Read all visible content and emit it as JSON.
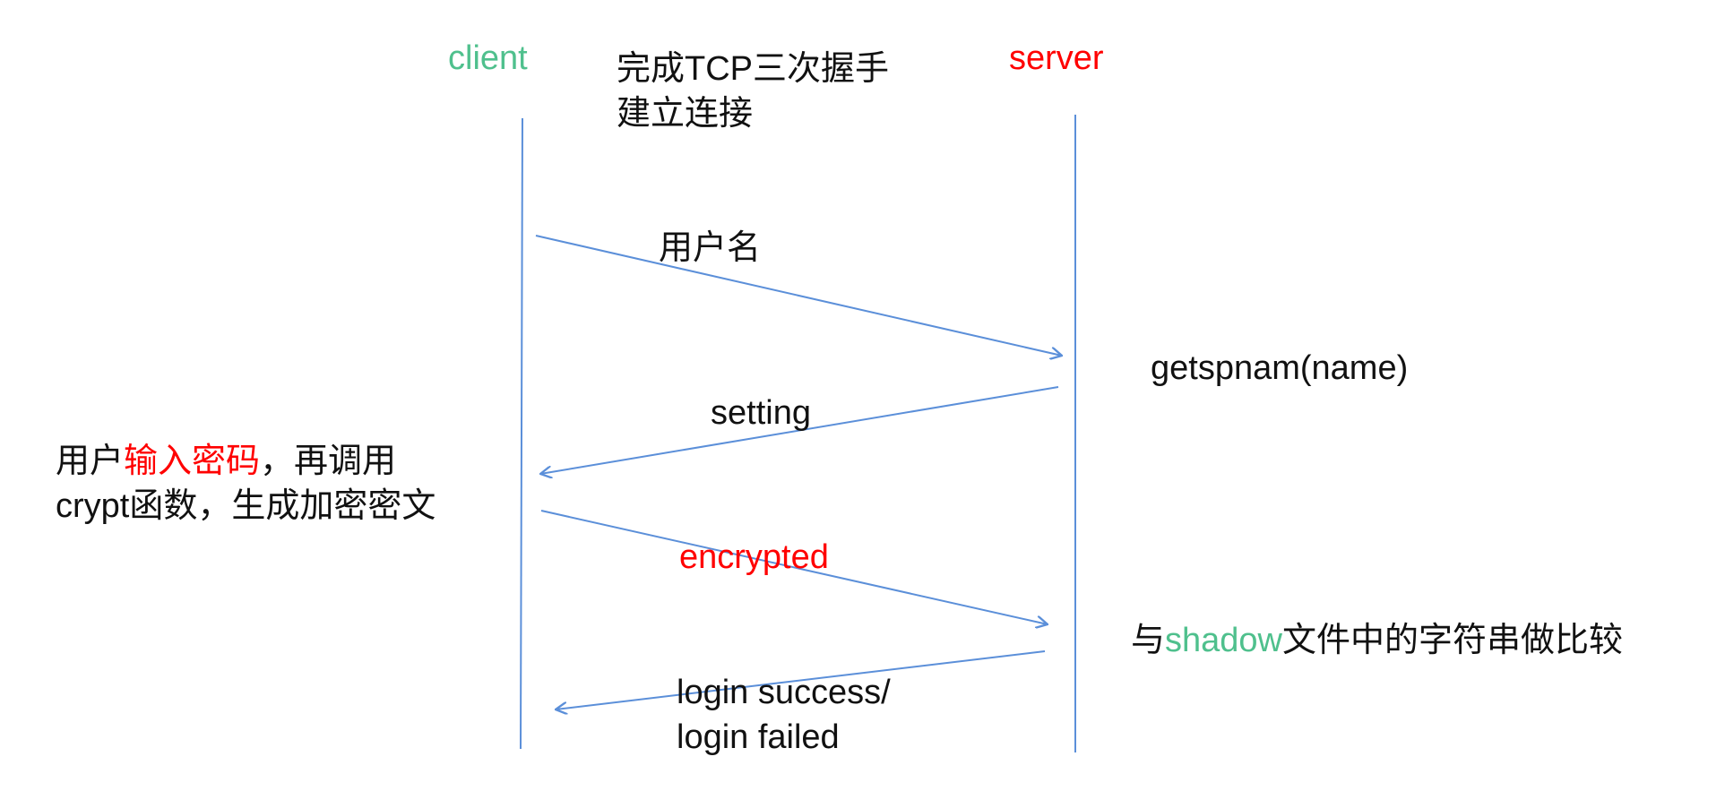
{
  "participants": {
    "client": "client",
    "server": "server"
  },
  "handshake": {
    "line1": "完成TCP三次握手",
    "line2": "建立连接"
  },
  "messages": {
    "username": "用户名",
    "setting": "setting",
    "encrypted": "encrypted",
    "result_line1": "login success/",
    "result_line2": "login failed"
  },
  "server_notes": {
    "getspnam": "getspnam(name)",
    "compare_prefix": "与",
    "compare_highlight": "shadow",
    "compare_suffix": "文件中的字符串做比较"
  },
  "client_note": {
    "line1_prefix": "用户",
    "line1_highlight": "输入密码",
    "line1_suffix": "，再调用",
    "line2": "crypt函数，生成加密密文"
  },
  "colors": {
    "lifeline": "#5b8fd9",
    "arrow": "#5b8fd9",
    "client_label": "#4fc08d",
    "server_label": "#ff0000",
    "highlight_red": "#ff0000",
    "highlight_green": "#4fc08d"
  }
}
